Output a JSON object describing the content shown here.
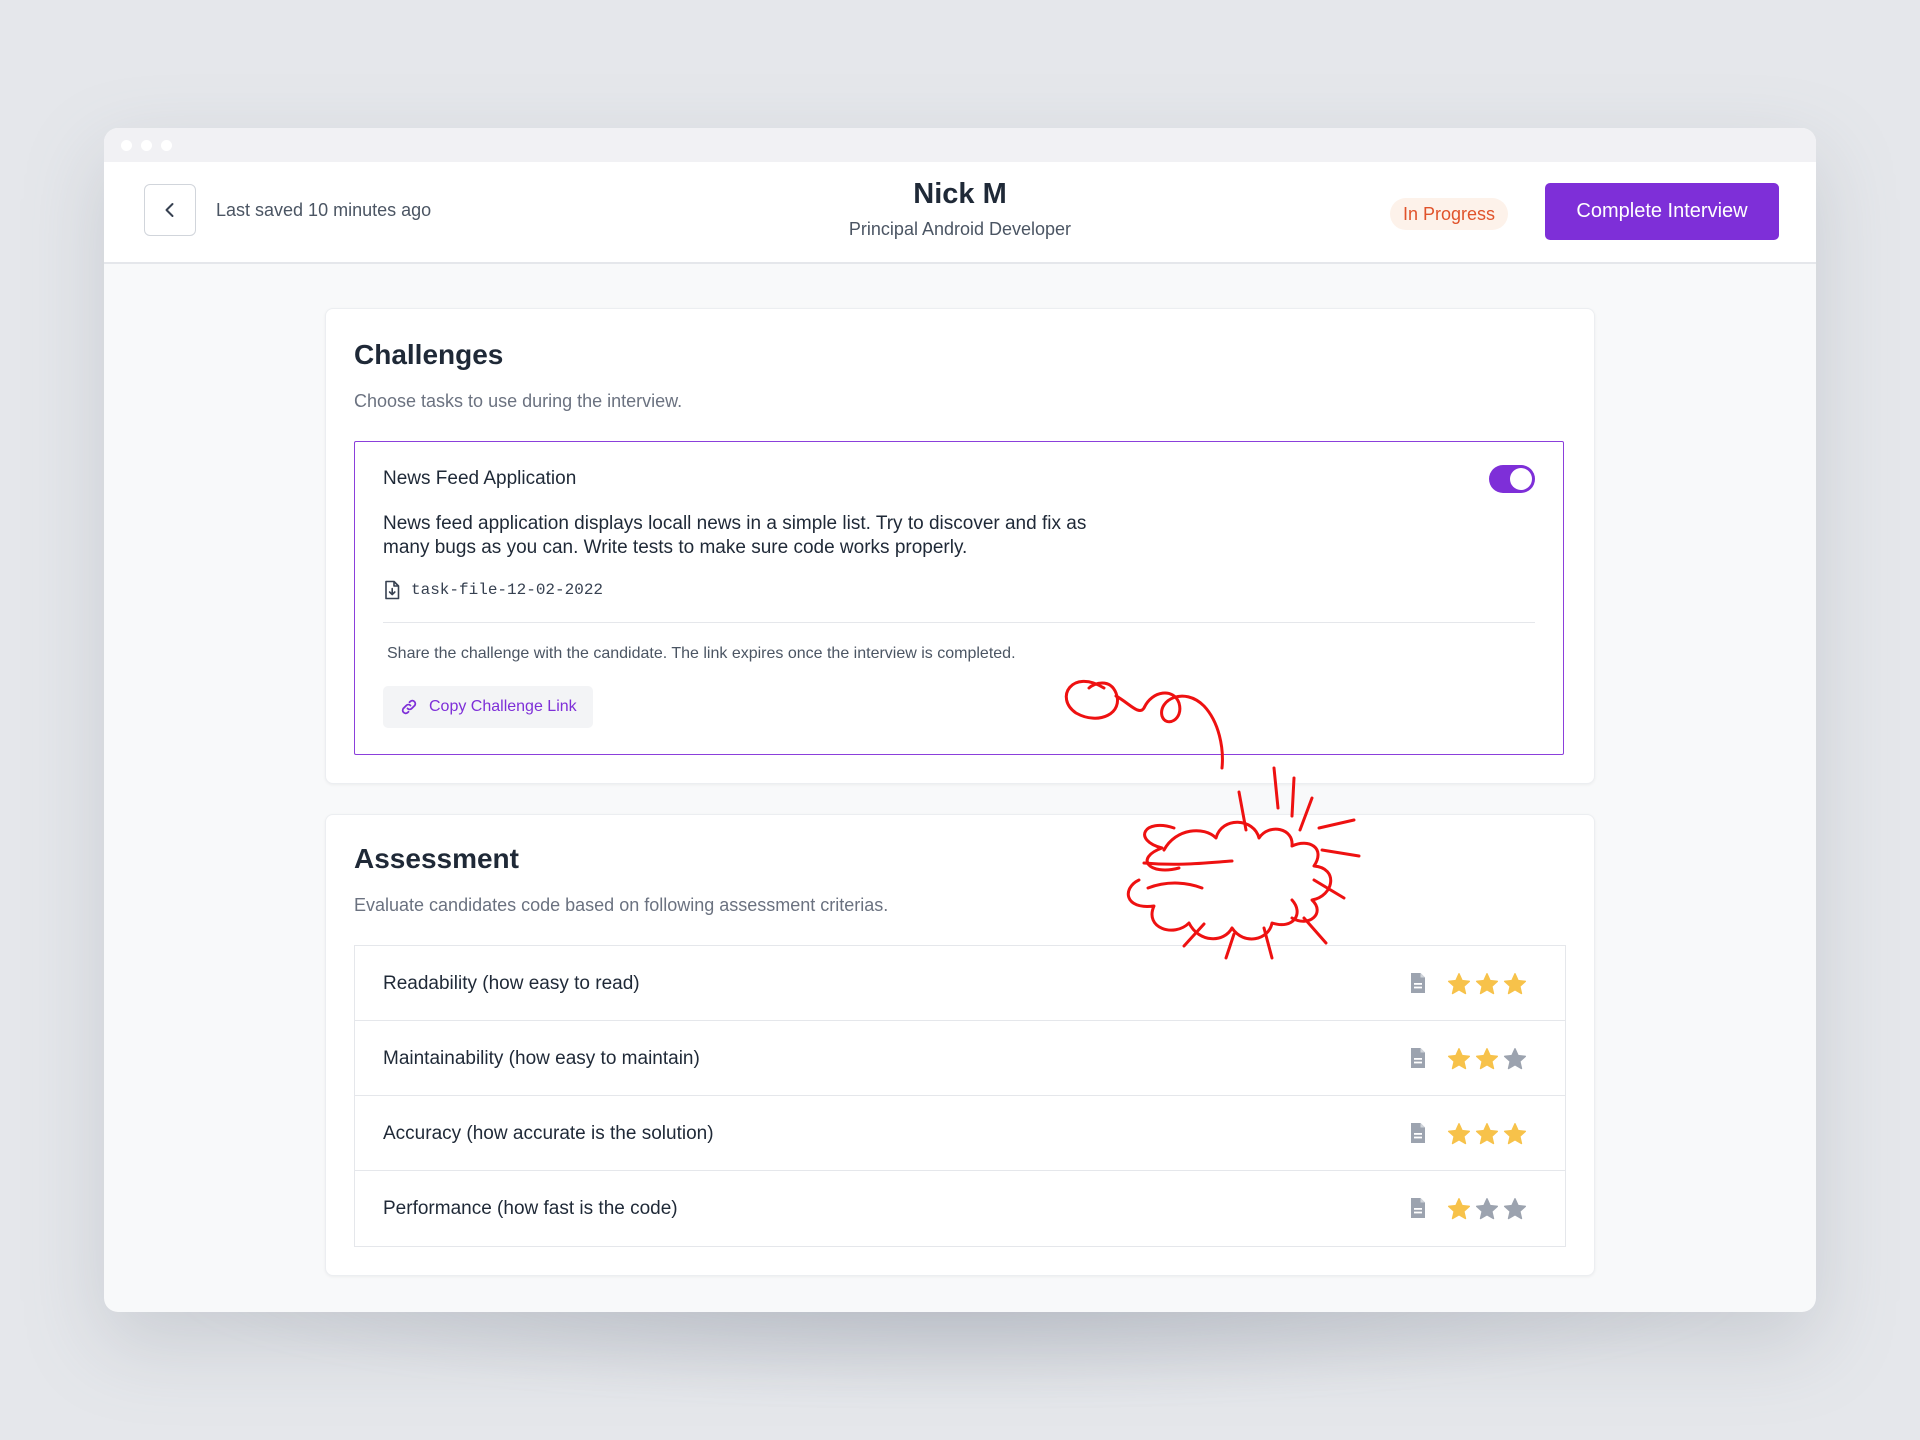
{
  "header": {
    "saved_text": "Last saved 10 minutes ago",
    "candidate_name": "Nick M",
    "candidate_role": "Principal Android Developer",
    "status_badge": "In Progress",
    "complete_button": "Complete Interview"
  },
  "challenges": {
    "title": "Challenges",
    "subtitle": "Choose tasks to use during the interview.",
    "item": {
      "title": "News Feed Application",
      "enabled": true,
      "description": "News feed application displays locall news in a simple list. Try to discover and fix as many bugs as you can. Write tests to make sure code works properly.",
      "file_name": "task-file-12-02-2022",
      "share_text": "Share the challenge with the candidate. The link expires once the interview is completed.",
      "copy_button": "Copy Challenge Link"
    }
  },
  "assessment": {
    "title": "Assessment",
    "subtitle": "Evaluate candidates code based on following assessment criterias.",
    "max_rating": 3,
    "criteria": [
      {
        "label": "Readability (how easy to read)",
        "rating": 3
      },
      {
        "label": "Maintainability (how easy to maintain)",
        "rating": 2
      },
      {
        "label": "Accuracy (how accurate is the solution)",
        "rating": 3
      },
      {
        "label": "Performance (how fast is the code)",
        "rating": 1
      }
    ]
  },
  "colors": {
    "accent": "#7e2fd8",
    "star_filled": "#f7c24a",
    "star_empty": "#9ca3af",
    "badge_text": "#e0532b",
    "annotation": "#ee1111"
  },
  "icons": {
    "back": "chevron-left-icon",
    "file": "file-download-icon",
    "link": "link-icon",
    "note": "document-icon",
    "star": "star-icon"
  }
}
